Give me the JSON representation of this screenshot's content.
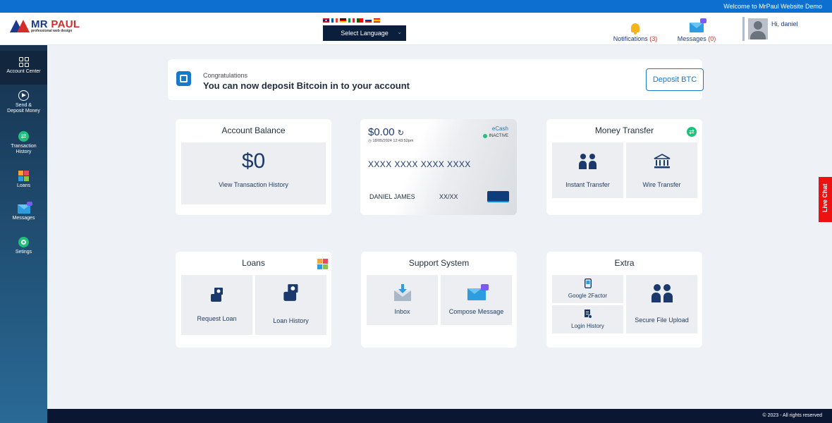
{
  "topbar": {
    "welcome": "Welcome to MrPaul Website Demo"
  },
  "header": {
    "logo": {
      "name_part1": "MR",
      "name_part2": "PAUL",
      "tagline": "professional web design"
    },
    "language": {
      "select_label": "Select Language",
      "flags": [
        "uk-flag",
        "france-flag",
        "germany-flag",
        "italy-flag",
        "portugal-flag",
        "russia-flag",
        "spain-flag"
      ]
    },
    "notifications": {
      "label": "Notifications",
      "count": "(3)"
    },
    "messages": {
      "label": "Messages",
      "count": "(0)"
    },
    "user": {
      "greeting": "Hi, daniel"
    }
  },
  "sidebar": {
    "items": [
      {
        "label": "Account Center",
        "icon": "grid-icon"
      },
      {
        "label": "Send &\nDeposit Money",
        "icon": "send-icon"
      },
      {
        "label": "Transaction\nHistory",
        "icon": "transfer-icon"
      },
      {
        "label": "Loans",
        "icon": "loans-icon"
      },
      {
        "label": "Messages",
        "icon": "envelope-icon"
      },
      {
        "label": "Setings",
        "icon": "gear-icon"
      }
    ]
  },
  "banner": {
    "subtitle": "Congratulations",
    "title": "You can now deposit Bitcoin in to your account",
    "button": "Deposit BTC"
  },
  "account_balance": {
    "title": "Account Balance",
    "amount": "$0",
    "link": "View Transaction History"
  },
  "ecash_card": {
    "amount": "$0.00",
    "refresh_icon": "↻",
    "date": "18/05/2024 12:43:52pm",
    "brand": "eCash",
    "status": "INACTIVE",
    "number": "XXXX XXXX XXXX XXXX",
    "holder": "DANIEL JAMES",
    "expiry": "XX/XX"
  },
  "money_transfer": {
    "title": "Money Transfer",
    "tiles": [
      "Instant Transfer",
      "Wire Transfer"
    ]
  },
  "loans": {
    "title": "Loans",
    "tiles": [
      "Request Loan",
      "Loan History"
    ]
  },
  "support": {
    "title": "Support System",
    "tiles": [
      "Inbox",
      "Compose Message"
    ]
  },
  "extra": {
    "title": "Extra",
    "tiles": [
      "Google 2Factor",
      "Login History",
      "Secure File Upload"
    ]
  },
  "live_chat": "Live Chat",
  "footer": {
    "copyright": "© 2023 - All rights reserved"
  },
  "colors": {
    "primary": "#1779c7",
    "sidebar": "#16324e",
    "accent_green": "#20c07a",
    "alert_red": "#d62b2b"
  }
}
